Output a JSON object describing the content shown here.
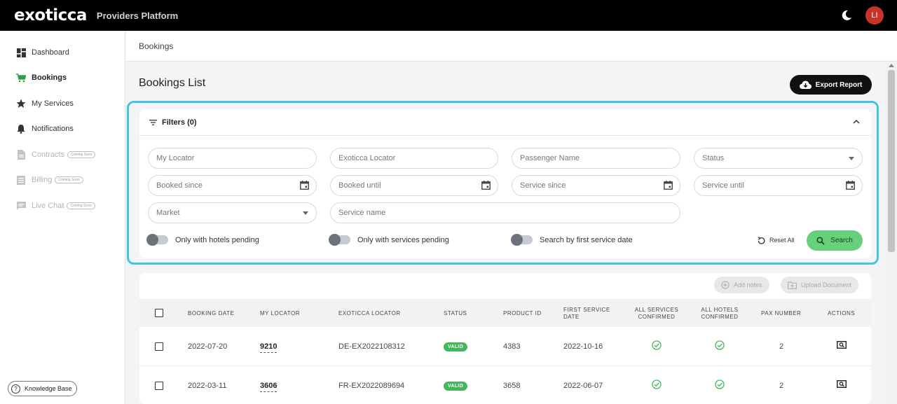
{
  "header": {
    "logo": "exoticca",
    "platform": "Providers Platform",
    "avatar_initials": "LI"
  },
  "sidebar": {
    "items": [
      {
        "label": "Dashboard",
        "icon": "dashboard-icon",
        "disabled": false
      },
      {
        "label": "Bookings",
        "icon": "cart-icon",
        "disabled": false,
        "active": true
      },
      {
        "label": "My Services",
        "icon": "star-icon",
        "disabled": false
      },
      {
        "label": "Notifications",
        "icon": "bell-icon",
        "disabled": false
      },
      {
        "label": "Contracts",
        "icon": "document-icon",
        "disabled": true,
        "badge": "Coming Soon"
      },
      {
        "label": "Billing",
        "icon": "billing-icon",
        "disabled": true,
        "badge": "Coming Soon"
      },
      {
        "label": "Live Chat",
        "icon": "chat-icon",
        "disabled": true,
        "badge": "Coming Soon"
      }
    ],
    "knowledge_base": "Knowledge Base"
  },
  "breadcrumb": "Bookings",
  "page": {
    "title": "Bookings List",
    "export_label": "Export Report"
  },
  "filters": {
    "title": "Filters (0)",
    "my_locator": "My Locator",
    "exoticca_locator": "Exoticca Locator",
    "passenger_name": "Passenger Name",
    "status": "Status",
    "booked_since": "Booked since",
    "booked_until": "Booked until",
    "service_since": "Service since",
    "service_until": "Service until",
    "market": "Market",
    "service_name": "Service name",
    "toggle_hotels": "Only with hotels pending",
    "toggle_services": "Only with services pending",
    "toggle_first_service": "Search by first service date",
    "reset_label": "Reset All",
    "search_label": "Search"
  },
  "table": {
    "add_notes": "Add notes",
    "upload_document": "Upload Document",
    "headers": {
      "booking_date": "BOOKING DATE",
      "my_locator": "MY LOCATOR",
      "exoticca_locator": "EXOTICCA LOCATOR",
      "status": "STATUS",
      "product_id": "PRODUCT ID",
      "first_service_1": "FIRST SERVICE",
      "first_service_2": "DATE",
      "all_services_1": "ALL SERVICES",
      "all_services_2": "CONFIRMED",
      "all_hotels_1": "ALL HOTELS",
      "all_hotels_2": "CONFIRMED",
      "pax_number": "PAX NUMBER",
      "actions": "ACTIONS"
    },
    "rows": [
      {
        "booking_date": "2022-07-20",
        "my_locator": "9210",
        "exoticca_locator": "DE-EX2022108312",
        "status": "VALID",
        "product_id": "4383",
        "first_service_date": "2022-10-16",
        "all_services_confirmed": true,
        "all_hotels_confirmed": true,
        "pax_number": "2"
      },
      {
        "booking_date": "2022-03-11",
        "my_locator": "3606",
        "exoticca_locator": "FR-EX2022089694",
        "status": "VALID",
        "product_id": "3658",
        "first_service_date": "2022-06-07",
        "all_services_confirmed": true,
        "all_hotels_confirmed": true,
        "pax_number": "2"
      }
    ]
  },
  "colors": {
    "accent_highlight": "#3fc6e0",
    "search_green": "#67d07a",
    "valid_green": "#43b85a",
    "active_nav": "#2e9e44"
  }
}
